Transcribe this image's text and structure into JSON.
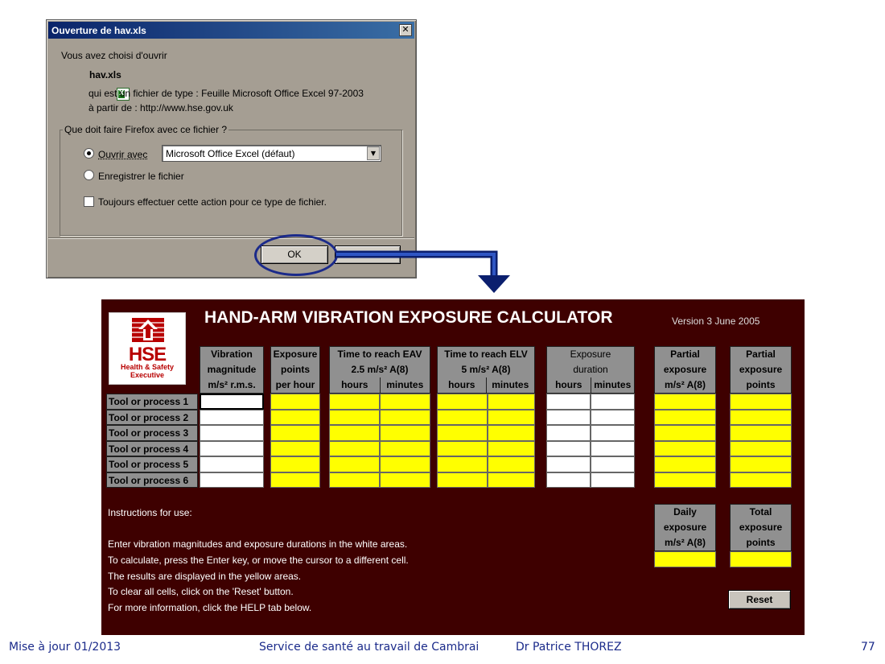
{
  "dialog": {
    "title": "Ouverture de hav.xls",
    "close_glyph": "✕",
    "intro": "Vous avez choisi d'ouvrir",
    "file_name": "hav.xls",
    "file_type_line": "qui est un fichier de type :  Feuille Microsoft Office Excel 97-2003",
    "source_line": "à partir de :  http://www.hse.gov.uk",
    "question": "Que doit faire Firefox avec ce fichier ?",
    "open_with_label": "Ouvrir avec",
    "open_with_value": "Microsoft Office Excel (défaut)",
    "save_label": "Enregistrer le fichier",
    "always_label": "Toujours effectuer cette action pour ce type de fichier.",
    "ok_label": "OK",
    "cancel_label": ""
  },
  "calculator": {
    "title": "HAND-ARM VIBRATION EXPOSURE CALCULATOR",
    "version": "Version 3  June 2005",
    "logo": {
      "mark": "HSE",
      "sub1": "Health & Safety",
      "sub2": "Executive"
    },
    "columns": {
      "vibration": [
        "Vibration",
        "magnitude",
        "m/s² r.m.s."
      ],
      "exposure_points": [
        "Exposure",
        "points",
        "per hour"
      ],
      "eav": [
        "Time to reach EAV",
        "2.5 m/s² A(8)"
      ],
      "elv": [
        "Time to reach ELV",
        "5 m/s² A(8)"
      ],
      "duration": [
        "Exposure",
        "duration"
      ],
      "partial_a8": [
        "Partial",
        "exposure",
        "m/s² A(8)"
      ],
      "partial_points": [
        "Partial",
        "exposure",
        "points"
      ],
      "hours": "hours",
      "minutes": "minutes"
    },
    "rows": [
      "Tool or process 1",
      "Tool or process 2",
      "Tool or process 3",
      "Tool or process 4",
      "Tool or process 5",
      "Tool or process 6"
    ],
    "daily": {
      "a8": [
        "Daily",
        "exposure",
        "m/s² A(8)"
      ],
      "points": [
        "Total",
        "exposure",
        "points"
      ]
    },
    "instructions": [
      "Instructions for use:",
      "Enter vibration magnitudes and exposure durations in the white areas.",
      "To calculate, press the Enter key, or move the cursor to a different cell.",
      "The results are displayed in the yellow areas.",
      "To clear all cells, click on the 'Reset' button.",
      "For more information, click the HELP tab below."
    ],
    "reset_label": "Reset"
  },
  "footer": {
    "date": "Mise à jour 01/2013",
    "service": "Service de santé au travail de Cambrai",
    "author": "Dr Patrice THOREZ",
    "page": "77"
  },
  "colors": {
    "calc_bg": "#3e0000",
    "header_grey": "#909090",
    "output_yellow": "#ffff00",
    "input_white": "#ffffff",
    "footer_blue": "#1a2a8a",
    "dialog_bg": "#a59e93"
  }
}
